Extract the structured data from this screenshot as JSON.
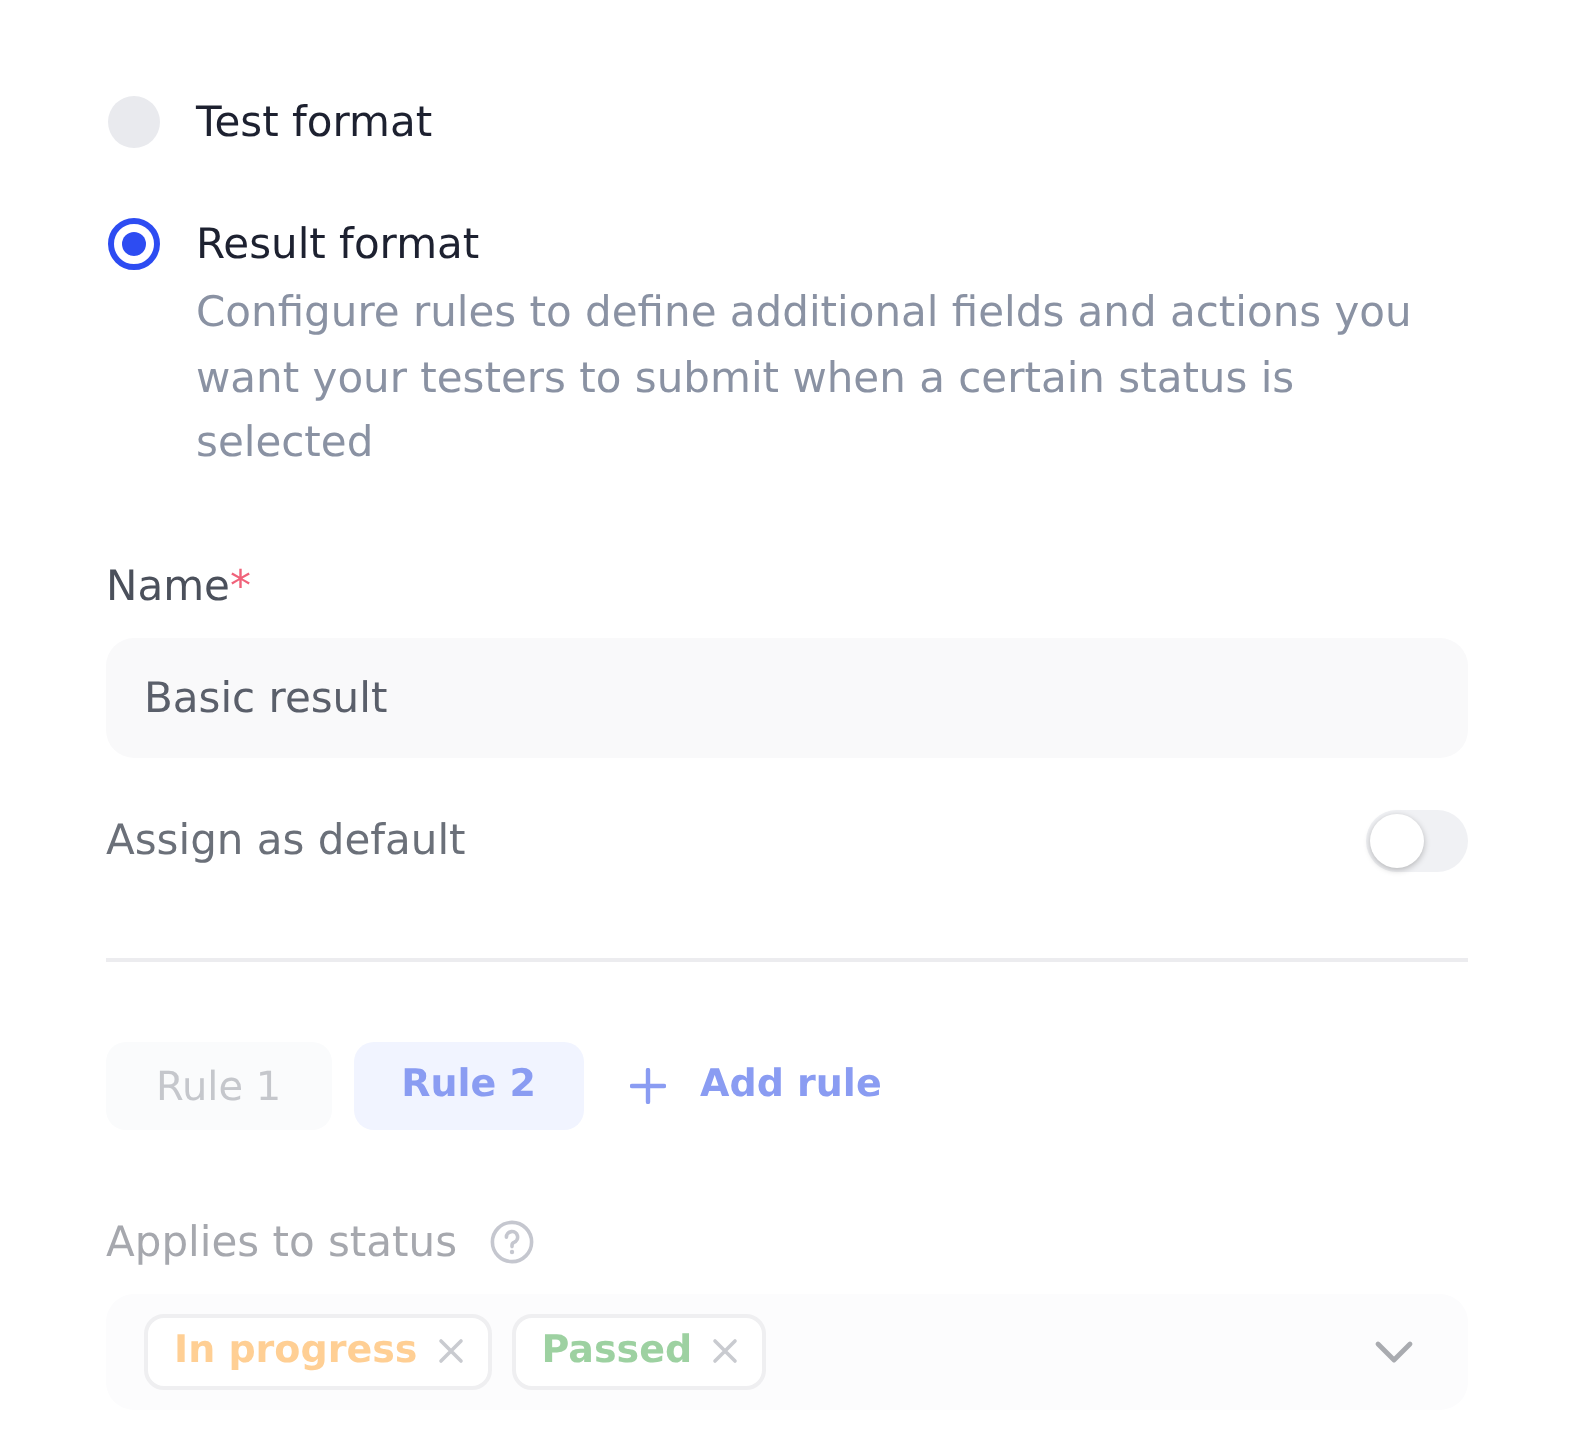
{
  "format_options": [
    {
      "label": "Test format",
      "selected": false
    },
    {
      "label": "Result format",
      "selected": true,
      "description": "Configure rules to define additional fields and actions you want your testers to submit when a certain status is selected"
    }
  ],
  "name_field": {
    "label": "Name",
    "required_mark": "*",
    "value": "Basic result"
  },
  "default_toggle": {
    "label": "Assign as default",
    "on": false
  },
  "rule_tabs": [
    {
      "label": "Rule 1",
      "selected": false
    },
    {
      "label": "Rule 2",
      "selected": true
    }
  ],
  "add_rule_button": {
    "label": "Add rule"
  },
  "status_field": {
    "label": "Applies to status",
    "tags": [
      {
        "label": "In progress",
        "color": "#ffcf94"
      },
      {
        "label": "Passed",
        "color": "#9dd1a1"
      }
    ]
  }
}
